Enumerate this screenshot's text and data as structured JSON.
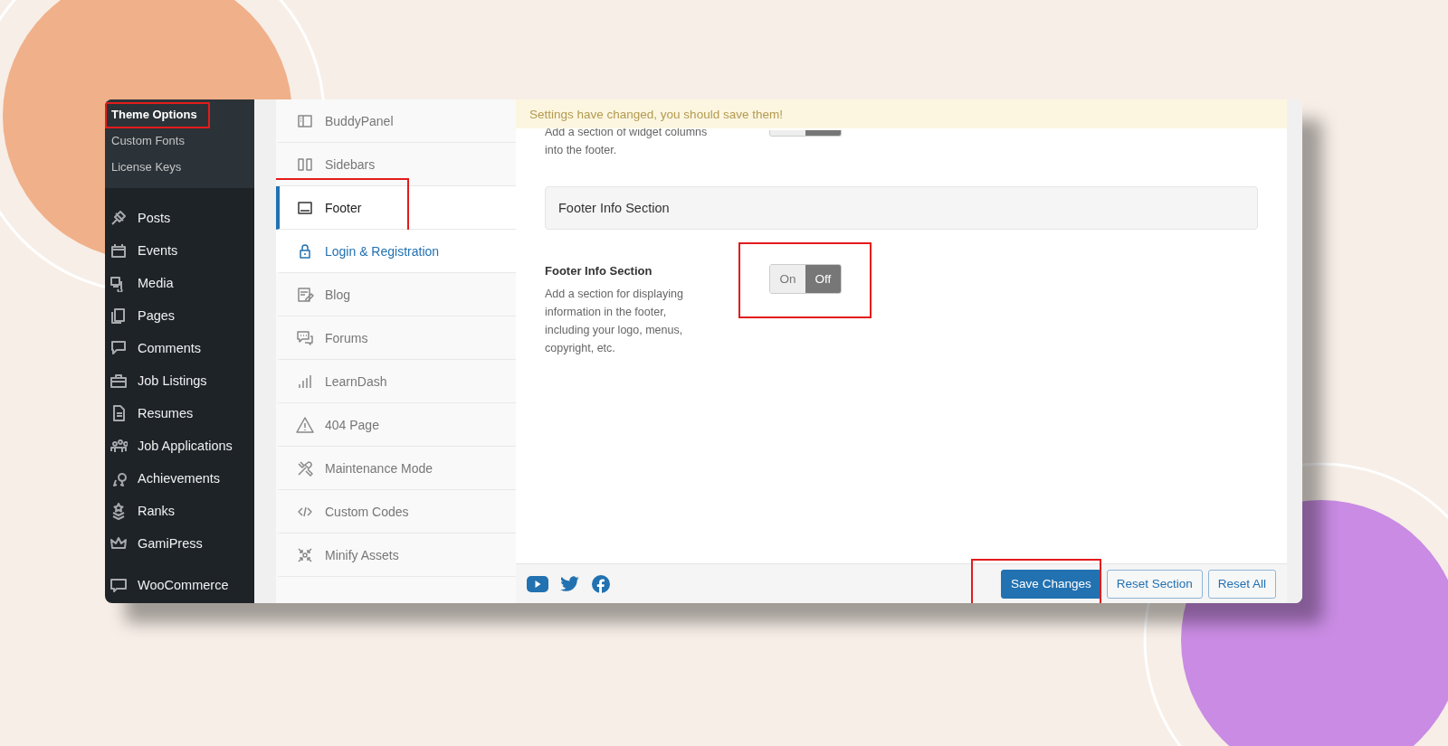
{
  "admin_menu": {
    "submenu": [
      {
        "label": "Theme Options",
        "selected": true,
        "highlighted": true
      },
      {
        "label": "Custom Fonts",
        "selected": false,
        "highlighted": false
      },
      {
        "label": "License Keys",
        "selected": false,
        "highlighted": false
      }
    ],
    "items": [
      {
        "label": "Posts"
      },
      {
        "label": "Events"
      },
      {
        "label": "Media"
      },
      {
        "label": "Pages"
      },
      {
        "label": "Comments"
      },
      {
        "label": "Job Listings"
      },
      {
        "label": "Resumes"
      },
      {
        "label": "Job Applications"
      },
      {
        "label": "Achievements"
      },
      {
        "label": "Ranks"
      },
      {
        "label": "GamiPress"
      },
      {
        "label": "WooCommerce"
      }
    ]
  },
  "settings_nav": [
    {
      "label": "BuddyPanel",
      "selected": false,
      "hovered": false,
      "highlighted": false
    },
    {
      "label": "Sidebars",
      "selected": false,
      "hovered": false,
      "highlighted": false
    },
    {
      "label": "Footer",
      "selected": true,
      "hovered": false,
      "highlighted": true
    },
    {
      "label": "Login & Registration",
      "selected": false,
      "hovered": true,
      "highlighted": false
    },
    {
      "label": "Blog",
      "selected": false,
      "hovered": false,
      "highlighted": false
    },
    {
      "label": "Forums",
      "selected": false,
      "hovered": false,
      "highlighted": false
    },
    {
      "label": "LearnDash",
      "selected": false,
      "hovered": false,
      "highlighted": false
    },
    {
      "label": "404 Page",
      "selected": false,
      "hovered": false,
      "highlighted": false
    },
    {
      "label": "Maintenance Mode",
      "selected": false,
      "hovered": false,
      "highlighted": false
    },
    {
      "label": "Custom Codes",
      "selected": false,
      "hovered": false,
      "highlighted": false
    },
    {
      "label": "Minify Assets",
      "selected": false,
      "hovered": false,
      "highlighted": false
    }
  ],
  "notice": "Settings have changed, you should save them!",
  "partial_field": {
    "description": "Add a section of widget columns into the footer.",
    "toggle": {
      "on": false
    }
  },
  "section_heading": "Footer Info Section",
  "field": {
    "title": "Footer Info Section",
    "description": "Add a section for displaying information in the footer, including your logo, menus, copyright, etc.",
    "toggle": {
      "on_label": "On",
      "off_label": "Off",
      "on": false,
      "highlighted": true
    }
  },
  "footer": {
    "buttons": [
      {
        "label": "Save Changes",
        "kind": "primary",
        "highlighted": true
      },
      {
        "label": "Reset Section",
        "kind": "secondary",
        "highlighted": false
      },
      {
        "label": "Reset All",
        "kind": "secondary",
        "highlighted": false
      }
    ]
  }
}
